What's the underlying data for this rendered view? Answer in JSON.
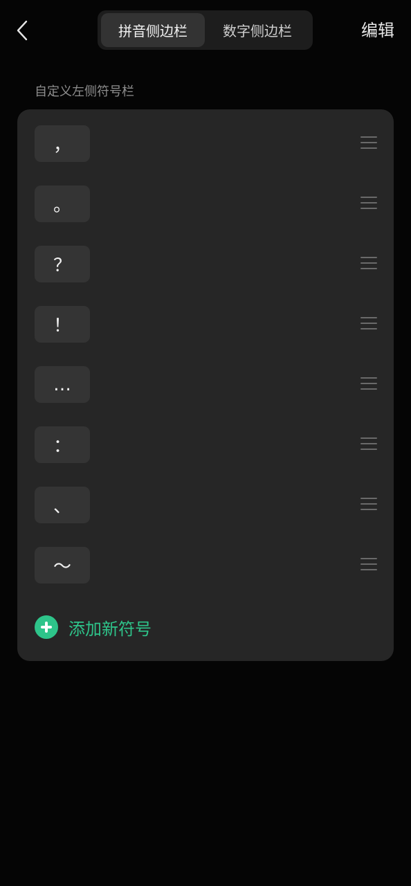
{
  "header": {
    "back_icon": "chevron-left-icon",
    "tabs": [
      {
        "label": "拼音侧边栏",
        "active": true
      },
      {
        "label": "数字侧边栏",
        "active": false
      }
    ],
    "edit_label": "编辑"
  },
  "section_title": "自定义左侧符号栏",
  "symbols": [
    {
      "char": "，"
    },
    {
      "char": "。"
    },
    {
      "char": "？"
    },
    {
      "char": "！"
    },
    {
      "char": "…"
    },
    {
      "char": "："
    },
    {
      "char": "、"
    },
    {
      "char": "～"
    }
  ],
  "add_button": {
    "label": "添加新符号",
    "icon": "plus-circle-icon"
  },
  "colors": {
    "background": "#050505",
    "card": "#262626",
    "accent": "#2ec48a"
  }
}
